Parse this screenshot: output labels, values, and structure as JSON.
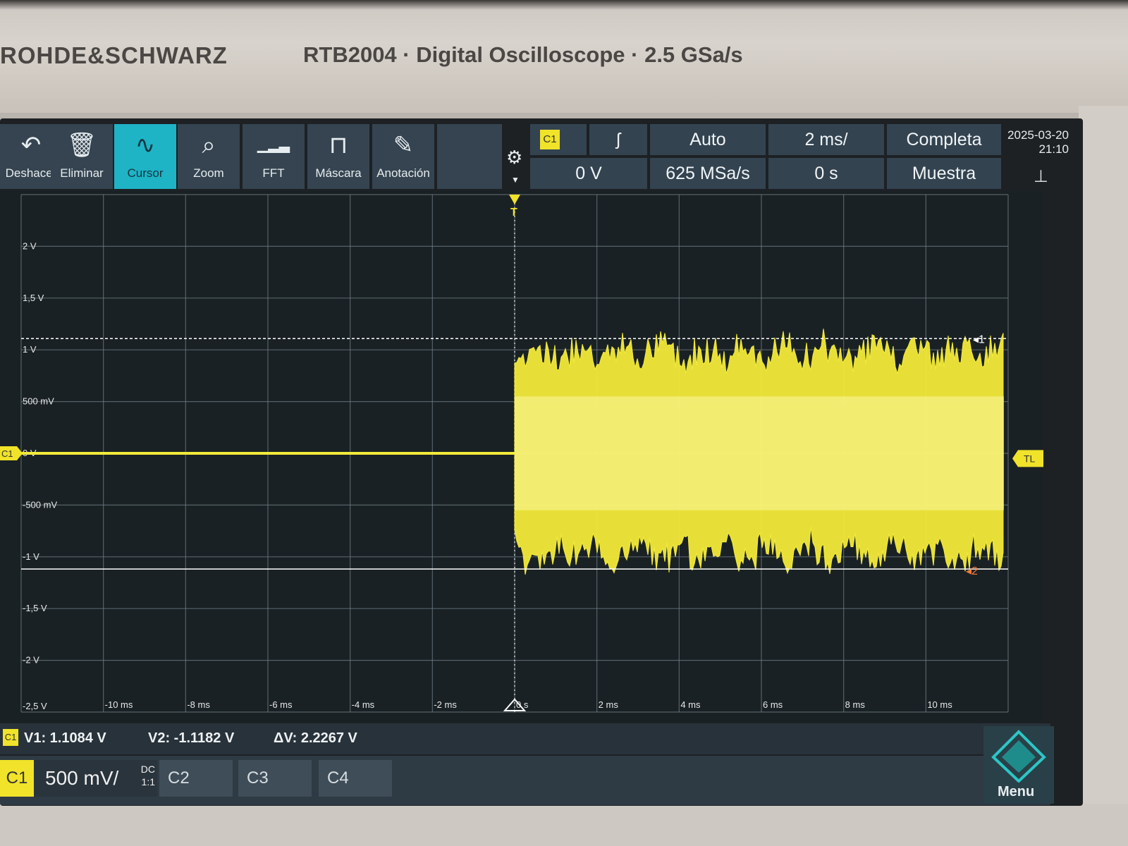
{
  "header": {
    "brand": "ROHDE&SCHWARZ",
    "model_line": "RTB2004 · Digital Oscilloscope · 2.5 GSa/s"
  },
  "toolbar": {
    "items": [
      {
        "label": "Deshacer",
        "icon": "undo-icon",
        "glyph": "↶"
      },
      {
        "label": "Eliminar",
        "icon": "trash-icon",
        "glyph": "🗑"
      },
      {
        "label": "Cursor",
        "icon": "cursor-wave-icon",
        "glyph": "∿"
      },
      {
        "label": "Zoom",
        "icon": "zoom-icon",
        "glyph": "⌕"
      },
      {
        "label": "FFT",
        "icon": "fft-icon",
        "glyph": "▁▂▃"
      },
      {
        "label": "Máscara",
        "icon": "mask-icon",
        "glyph": "⊓"
      },
      {
        "label": "Anotación",
        "icon": "pencil-icon",
        "glyph": "✎"
      }
    ],
    "active": "Cursor"
  },
  "settings": {
    "trigger_source": "C1",
    "trigger_slope": "ʃ",
    "trigger_level": "0 V",
    "trigger_mode": "Auto",
    "sample_rate": "625 MSa/s",
    "timebase": "2 ms/",
    "time_offset": "0 s",
    "acq_mode": "Completa",
    "acq_type": "Muestra",
    "date": "2025-03-20",
    "time": "21:10"
  },
  "graticule": {
    "y_labels": [
      "2 V",
      "1,5 V",
      "1 V",
      "500 mV",
      "0 V",
      "-500 mV",
      "-1 V",
      "-1,5 V",
      "-2 V",
      "-2,5 V"
    ],
    "x_labels": [
      "-10 ms",
      "-8 ms",
      "-6 ms",
      "-4 ms",
      "-2 ms",
      "0 s",
      "2 ms",
      "4 ms",
      "6 ms",
      "8 ms",
      "10 ms"
    ],
    "trigger_marker": "T",
    "trigger_level_marker": "TL",
    "channel_marker": "C1",
    "cursor1_marker": "1",
    "cursor2_marker": "2"
  },
  "chart_data": {
    "type": "line",
    "x_unit": "ms",
    "y_unit": "V",
    "xlim": [
      -12,
      12
    ],
    "ylim": [
      -2.5,
      2.5
    ],
    "series": [
      {
        "name": "C1",
        "color": "#f2ea3a",
        "envelope": {
          "x": [
            -12,
            0,
            0,
            12
          ],
          "y_max": [
            0,
            0,
            1.1,
            1.1
          ],
          "y_min": [
            0,
            0,
            -1.1,
            -1.1
          ]
        }
      }
    ],
    "cursors": {
      "v1": 1.1084,
      "v2": -1.1182
    }
  },
  "readout": {
    "channel": "C1",
    "v1": "V1: 1.1084 V",
    "v2": "V2: -1.1182 V",
    "dv": "ΔV: 2.2267 V"
  },
  "channels": {
    "c1": "C1",
    "c1_scale": "500 mV/",
    "c1_coupling": "DC",
    "c1_probe": "1:1",
    "c2": "C2",
    "c3": "C3",
    "c4": "C4"
  },
  "menu": {
    "label": "Menu"
  }
}
